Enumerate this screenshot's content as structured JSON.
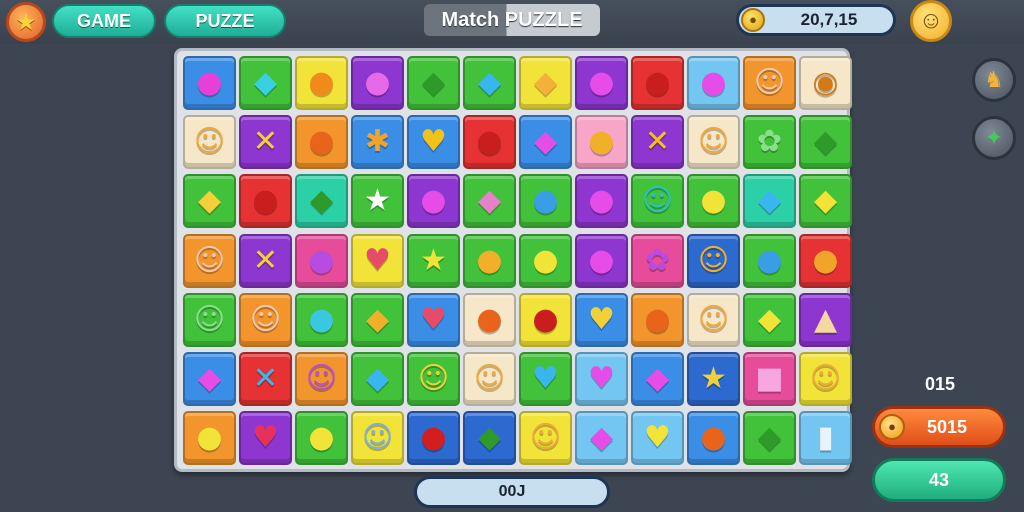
{
  "header": {
    "star_icon": "★",
    "game_label": "GAME",
    "puzzle_label": "PUZZE",
    "title": "Match PUZZLE",
    "score": "20,7,15",
    "coin_icon": "●",
    "smiley_icon": "☺"
  },
  "sidebar": {
    "tool1_icon": "♞",
    "tool2_icon": "✦",
    "moves_label": "015",
    "coins_value": "5015",
    "action_value": "43"
  },
  "footer": {
    "counter": "00J"
  },
  "colors": {
    "pu": "#8e36d0",
    "gr": "#41c23a",
    "ye": "#f2e338",
    "bl": "#3a8ee6",
    "re": "#e63232",
    "or": "#f2952c",
    "pi": "#f7a6c8",
    "cr": "#f5e7c8",
    "te": "#2bd0a6",
    "lb": "#74c6f2",
    "ma": "#e64c9a",
    "db": "#2d6ad0"
  },
  "board": {
    "rows": [
      [
        {
          "bg": "bl",
          "glyph": "●",
          "color": "#e640d8"
        },
        {
          "bg": "gr",
          "glyph": "◆",
          "color": "#39d0e0"
        },
        {
          "bg": "ye",
          "glyph": "●",
          "color": "#f08a1a"
        },
        {
          "bg": "pu",
          "glyph": "●",
          "color": "#e66ae8"
        },
        {
          "bg": "gr",
          "glyph": "◆",
          "color": "#2d9a2a"
        },
        {
          "bg": "gr",
          "glyph": "◆",
          "color": "#39b6f0"
        },
        {
          "bg": "ye",
          "glyph": "◆",
          "color": "#f5b03a"
        },
        {
          "bg": "pu",
          "glyph": "●",
          "color": "#e64ce8"
        },
        {
          "bg": "re",
          "glyph": "●",
          "color": "#c81e1e"
        },
        {
          "bg": "lb",
          "glyph": "●",
          "color": "#e64ce8"
        },
        {
          "bg": "or",
          "glyph": "☺",
          "color": "#f5c8b0"
        },
        {
          "bg": "cr",
          "glyph": "◉",
          "color": "#d27a1a"
        }
      ],
      [
        {
          "bg": "cr",
          "glyph": "☺",
          "color": "#f0a83a"
        },
        {
          "bg": "pu",
          "glyph": "✕",
          "color": "#f2d038"
        },
        {
          "bg": "or",
          "glyph": "●",
          "color": "#e8641a"
        },
        {
          "bg": "bl",
          "glyph": "✱",
          "color": "#f2a32a"
        },
        {
          "bg": "bl",
          "glyph": "♥",
          "color": "#f2c21a"
        },
        {
          "bg": "re",
          "glyph": "●",
          "color": "#c81e1e"
        },
        {
          "bg": "bl",
          "glyph": "◆",
          "color": "#e64ce8"
        },
        {
          "bg": "pi",
          "glyph": "●",
          "color": "#f2b02a"
        },
        {
          "bg": "pu",
          "glyph": "✕",
          "color": "#f2c21a"
        },
        {
          "bg": "cr",
          "glyph": "☺",
          "color": "#f0a83a"
        },
        {
          "bg": "gr",
          "glyph": "✿",
          "color": "#8ae08a"
        },
        {
          "bg": "gr",
          "glyph": "◆",
          "color": "#2d9a2a"
        }
      ],
      [
        {
          "bg": "gr",
          "glyph": "◆",
          "color": "#f2d038"
        },
        {
          "bg": "re",
          "glyph": "●",
          "color": "#c81e1e"
        },
        {
          "bg": "te",
          "glyph": "◆",
          "color": "#2d9a2a"
        },
        {
          "bg": "gr",
          "glyph": "★",
          "color": "#ffffff"
        },
        {
          "bg": "pu",
          "glyph": "●",
          "color": "#e64ce8"
        },
        {
          "bg": "gr",
          "glyph": "◆",
          "color": "#e680c8"
        },
        {
          "bg": "gr",
          "glyph": "●",
          "color": "#3a9ee6"
        },
        {
          "bg": "pu",
          "glyph": "●",
          "color": "#e64ce8"
        },
        {
          "bg": "gr",
          "glyph": "☺",
          "color": "#2ac0c8"
        },
        {
          "bg": "gr",
          "glyph": "●",
          "color": "#f2e338"
        },
        {
          "bg": "te",
          "glyph": "◆",
          "color": "#39b6f0"
        },
        {
          "bg": "gr",
          "glyph": "◆",
          "color": "#f2e338"
        }
      ],
      [
        {
          "bg": "or",
          "glyph": "☺",
          "color": "#f5c8b0"
        },
        {
          "bg": "pu",
          "glyph": "✕",
          "color": "#f2d038"
        },
        {
          "bg": "ma",
          "glyph": "●",
          "color": "#b84ce0"
        },
        {
          "bg": "ye",
          "glyph": "♥",
          "color": "#e64c68"
        },
        {
          "bg": "gr",
          "glyph": "★",
          "color": "#f2e338"
        },
        {
          "bg": "gr",
          "glyph": "●",
          "color": "#f2b02a"
        },
        {
          "bg": "gr",
          "glyph": "●",
          "color": "#f2e338"
        },
        {
          "bg": "pu",
          "glyph": "●",
          "color": "#e64ce8"
        },
        {
          "bg": "ma",
          "glyph": "✿",
          "color": "#b84ce0"
        },
        {
          "bg": "db",
          "glyph": "☺",
          "color": "#f2b02a"
        },
        {
          "bg": "gr",
          "glyph": "●",
          "color": "#3a9ee6"
        },
        {
          "bg": "re",
          "glyph": "●",
          "color": "#f2a32a"
        }
      ],
      [
        {
          "bg": "gr",
          "glyph": "☺",
          "color": "#8ae08a"
        },
        {
          "bg": "or",
          "glyph": "☺",
          "color": "#f5c8b0"
        },
        {
          "bg": "gr",
          "glyph": "●",
          "color": "#39c8e0"
        },
        {
          "bg": "gr",
          "glyph": "◆",
          "color": "#f2b02a"
        },
        {
          "bg": "bl",
          "glyph": "♥",
          "color": "#e64c68"
        },
        {
          "bg": "cr",
          "glyph": "●",
          "color": "#e8641a"
        },
        {
          "bg": "ye",
          "glyph": "●",
          "color": "#c81e1e"
        },
        {
          "bg": "bl",
          "glyph": "♥",
          "color": "#f2d038"
        },
        {
          "bg": "or",
          "glyph": "●",
          "color": "#e8641a"
        },
        {
          "bg": "cr",
          "glyph": "☺",
          "color": "#f0a83a"
        },
        {
          "bg": "gr",
          "glyph": "◆",
          "color": "#f2e338"
        },
        {
          "bg": "pu",
          "glyph": "▲",
          "color": "#f5d7a0"
        }
      ],
      [
        {
          "bg": "bl",
          "glyph": "◆",
          "color": "#e64ce8"
        },
        {
          "bg": "re",
          "glyph": "✕",
          "color": "#39b6f0"
        },
        {
          "bg": "or",
          "glyph": "☺",
          "color": "#b84ce0"
        },
        {
          "bg": "gr",
          "glyph": "◆",
          "color": "#39b6f0"
        },
        {
          "bg": "gr",
          "glyph": "☺",
          "color": "#f2d038"
        },
        {
          "bg": "cr",
          "glyph": "☺",
          "color": "#f0a83a"
        },
        {
          "bg": "gr",
          "glyph": "♥",
          "color": "#39b6f0"
        },
        {
          "bg": "lb",
          "glyph": "♥",
          "color": "#e64ce8"
        },
        {
          "bg": "bl",
          "glyph": "◆",
          "color": "#e64ce8"
        },
        {
          "bg": "db",
          "glyph": "★",
          "color": "#f2d038"
        },
        {
          "bg": "ma",
          "glyph": "■",
          "color": "#f7a6e0"
        },
        {
          "bg": "ye",
          "glyph": "☺",
          "color": "#f0a83a"
        }
      ],
      [
        {
          "bg": "or",
          "glyph": "●",
          "color": "#f2e338"
        },
        {
          "bg": "pu",
          "glyph": "♥",
          "color": "#e6325a"
        },
        {
          "bg": "gr",
          "glyph": "●",
          "color": "#f2e338"
        },
        {
          "bg": "ye",
          "glyph": "☺",
          "color": "#7ab0e0"
        },
        {
          "bg": "db",
          "glyph": "●",
          "color": "#d21e1e"
        },
        {
          "bg": "db",
          "glyph": "◆",
          "color": "#2d9a2a"
        },
        {
          "bg": "ye",
          "glyph": "☺",
          "color": "#f0a83a"
        },
        {
          "bg": "lb",
          "glyph": "◆",
          "color": "#e64ce8"
        },
        {
          "bg": "lb",
          "glyph": "♥",
          "color": "#f2e338"
        },
        {
          "bg": "bl",
          "glyph": "●",
          "color": "#e8641a"
        },
        {
          "bg": "gr",
          "glyph": "◆",
          "color": "#2d9a2a"
        },
        {
          "bg": "lb",
          "glyph": "▮",
          "color": "#e8f4fc"
        }
      ]
    ]
  }
}
